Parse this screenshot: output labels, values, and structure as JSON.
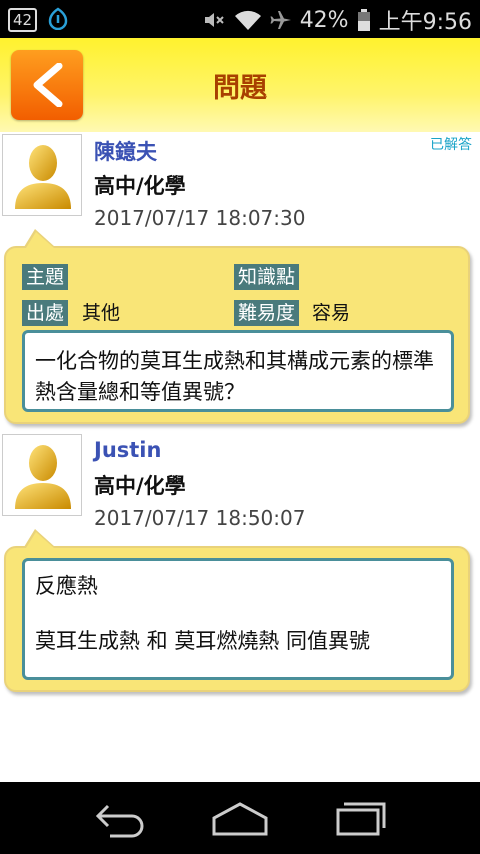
{
  "status_bar": {
    "notification_badge": "42",
    "battery_percent": "42%",
    "clock": "上午9:56"
  },
  "header": {
    "title": "問題"
  },
  "question": {
    "author": "陳鐿夫",
    "course": "高中/化學",
    "timestamp": "2017/07/17 18:07:30",
    "status": "已解答",
    "labels": {
      "subject": "主題",
      "knowledge_point": "知識點",
      "source": "出處",
      "difficulty": "難易度"
    },
    "source_value": "其他",
    "difficulty_value": "容易",
    "body": "一化合物的莫耳生成熱和其構成元素的標準熱含量總和等值異號？"
  },
  "answer": {
    "author": "Justin",
    "course": "高中/化學",
    "timestamp": "2017/07/17 18:50:07",
    "body_line1": "反應熱",
    "body_line2": "莫耳生成熱 和 莫耳燃燒熱 同值異號"
  },
  "icons": {
    "back": "chevron-left-icon",
    "avatar": "user-silhouette-icon",
    "nav_back": "back-arrow-icon",
    "nav_home": "home-icon",
    "nav_recents": "recent-apps-icon"
  },
  "colors": {
    "accent_orange": "#f57a10",
    "title_text": "#a84000",
    "name_blue": "#3b52b4",
    "status_cyan": "#1aa3c8",
    "bubble_yellow": "#f9e577",
    "tag_teal": "#4a7a7c"
  }
}
